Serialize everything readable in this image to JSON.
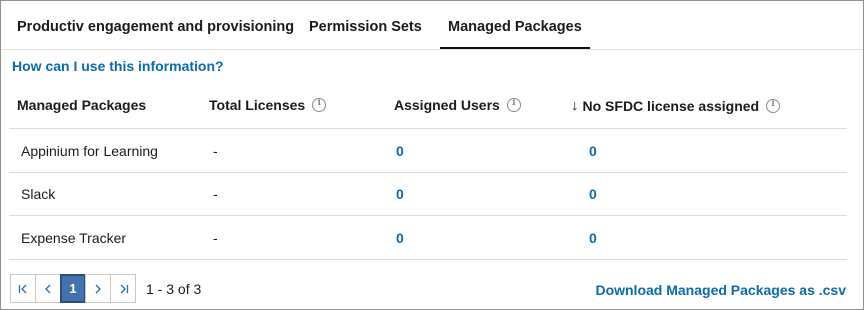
{
  "tabs": [
    {
      "label": "Productiv engagement and provisioning",
      "active": false
    },
    {
      "label": "Permission Sets",
      "active": false
    },
    {
      "label": "Managed Packages",
      "active": true
    }
  ],
  "help_link": "How can I use this information?",
  "table": {
    "columns": [
      {
        "label": "Managed Packages",
        "info": false,
        "sort": false
      },
      {
        "label": "Total Licenses",
        "info": true,
        "sort": false
      },
      {
        "label": "Assigned Users",
        "info": true,
        "sort": false
      },
      {
        "label": "No SFDC license assigned",
        "info": true,
        "sort": "descending"
      }
    ],
    "rows": [
      {
        "name": "Appinium for Learning",
        "total_licenses": "-",
        "assigned_users": "0",
        "no_sfdc": "0"
      },
      {
        "name": "Slack",
        "total_licenses": "-",
        "assigned_users": "0",
        "no_sfdc": "0"
      },
      {
        "name": "Expense Tracker",
        "total_licenses": "-",
        "assigned_users": "0",
        "no_sfdc": "0"
      }
    ]
  },
  "pagination": {
    "first_icon": "first-page-icon",
    "prev_icon": "chevron-left-icon",
    "current_page": "1",
    "next_icon": "chevron-right-icon",
    "last_icon": "last-page-icon",
    "range_text": "1 - 3 of 3"
  },
  "download_link": "Download Managed Packages as .csv",
  "colors": {
    "link": "#0b6bab",
    "current_page_bg": "#4472ae"
  }
}
